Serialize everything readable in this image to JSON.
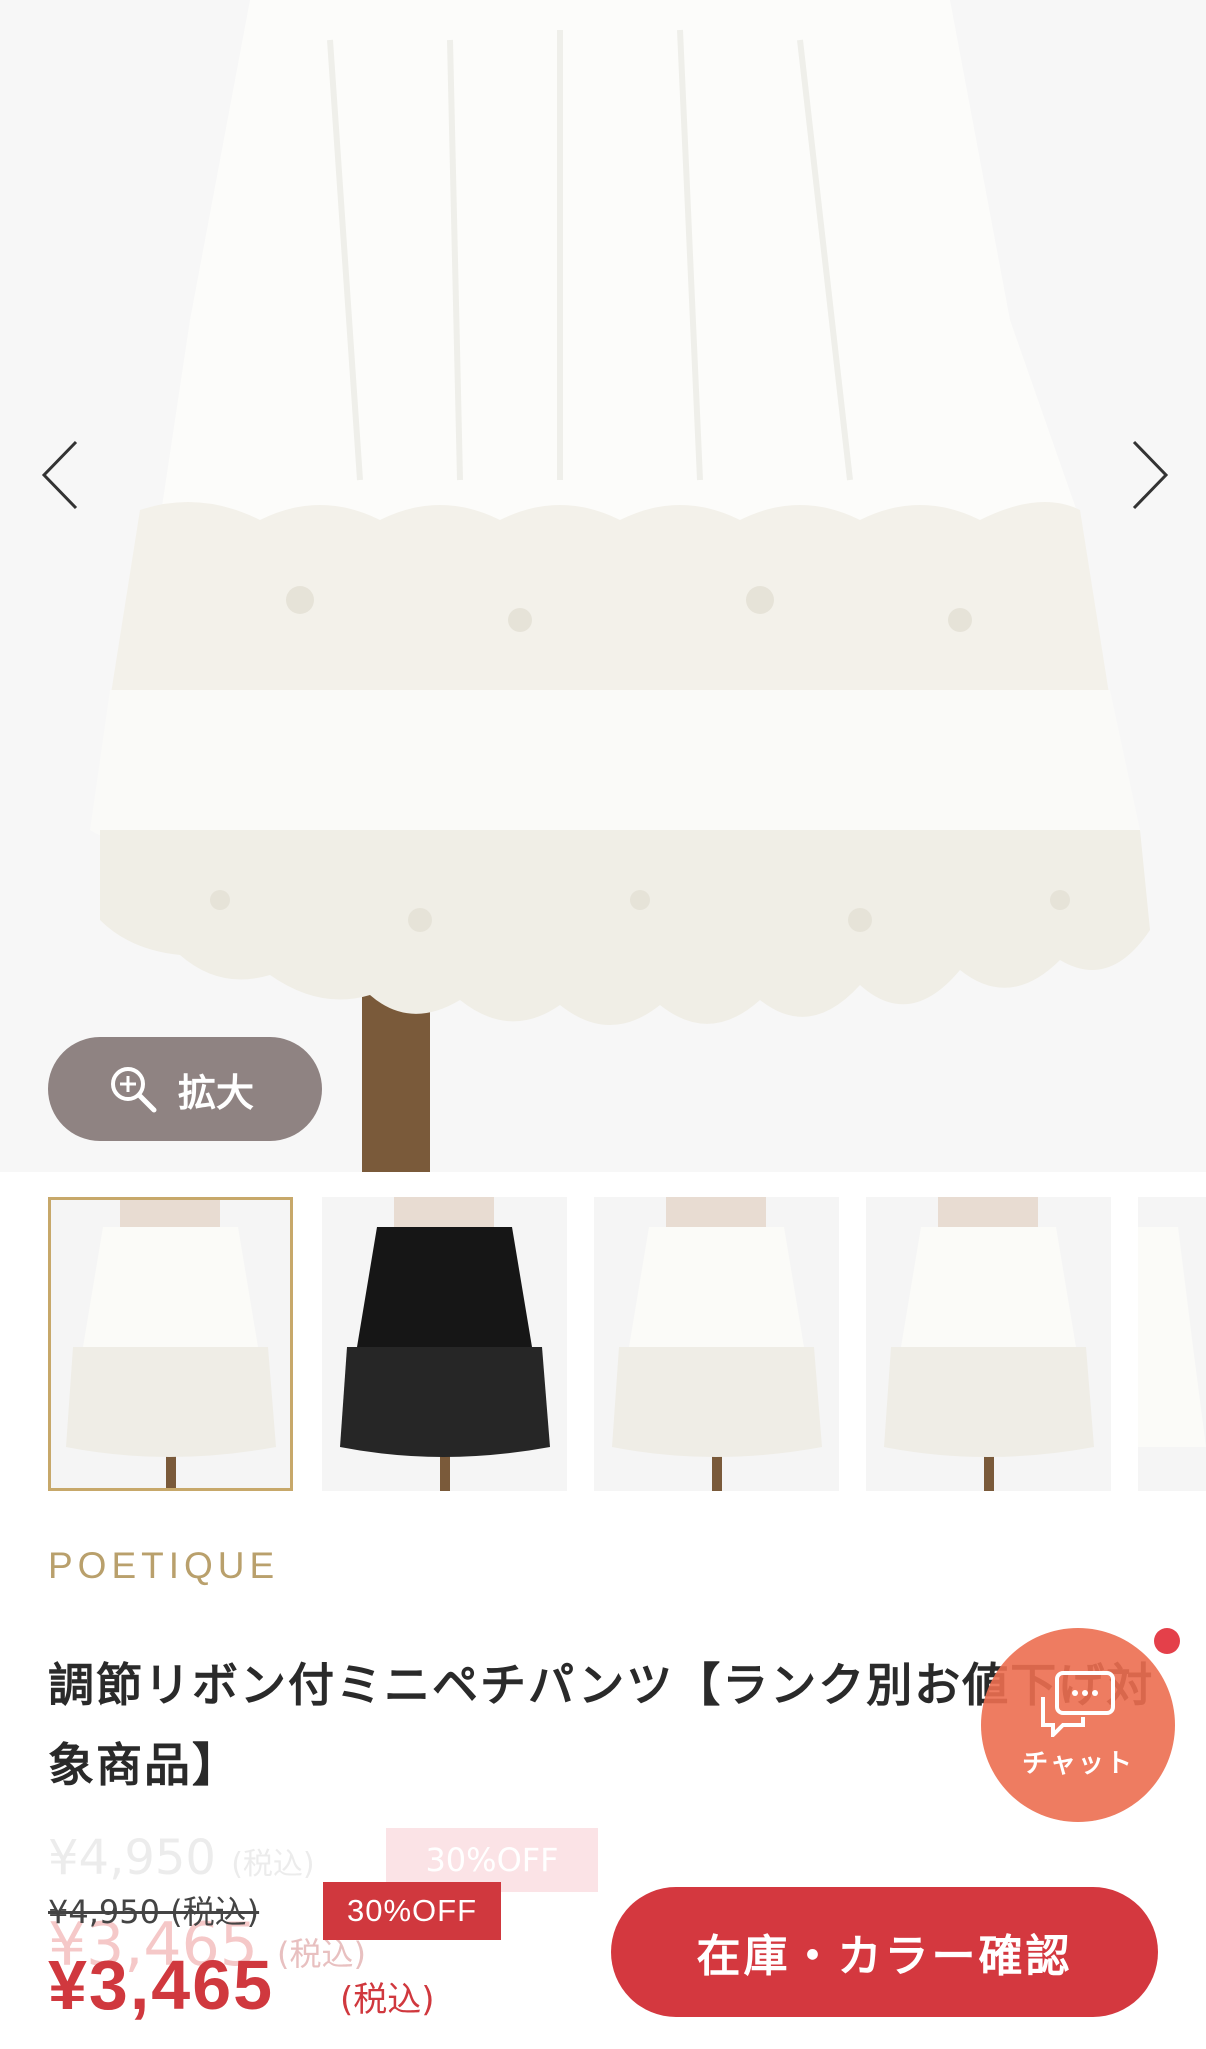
{
  "gallery": {
    "zoom_label": "拡大",
    "prev_icon": "chevron-left-icon",
    "next_icon": "chevron-right-icon",
    "thumbnails": [
      {
        "color": "white",
        "selected": true
      },
      {
        "color": "black",
        "selected": false
      },
      {
        "color": "white",
        "selected": false
      },
      {
        "color": "white",
        "selected": false
      },
      {
        "color": "white",
        "selected": false
      }
    ]
  },
  "product": {
    "brand": "POETIQUE",
    "title": "調節リボン付ミニペチパンツ【ランク別お値下げ対象商品】",
    "ghost_price": "¥4,950",
    "ghost_tax": "(税込)",
    "ghost_off": "30%OFF",
    "ghost_sale_price": "¥3,465",
    "ghost_sale_tax": "(税込)",
    "original_price": "¥4,950 (税込)",
    "discount_badge": "30%OFF",
    "sale_price": "¥3,465",
    "sale_tax": "(税込)"
  },
  "actions": {
    "stock_button": "在庫・カラー確認",
    "chat_label": "チャット"
  },
  "colors": {
    "accent": "#d0383e",
    "brand": "#b9a06c",
    "chat": "#ec6e50"
  }
}
